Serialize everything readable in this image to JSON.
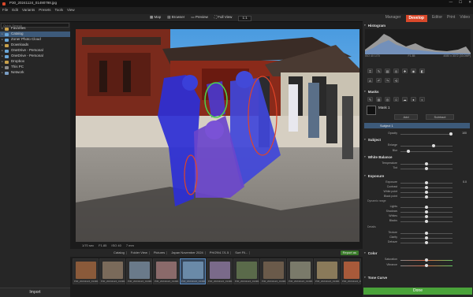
{
  "window": {
    "title": "P30_20241124_01490798.jpg"
  },
  "menu": [
    "File",
    "Edit",
    "Variants",
    "Presets",
    "Tools",
    "View"
  ],
  "toolbar": {
    "buttons": [
      "Map",
      "Browser",
      "Preview",
      "Full View"
    ],
    "user": "milesmoore@...",
    "zoom": "1:1"
  },
  "sidebar": {
    "search_placeholder": "Quick Search",
    "items": [
      {
        "label": "Favorites",
        "icon": "star-icon"
      },
      {
        "label": "Catalog",
        "icon": "catalog-icon"
      },
      {
        "label": "Zoner Photo Cloud",
        "icon": "cloud-icon"
      },
      {
        "label": "Downloads",
        "icon": "folder-icon"
      },
      {
        "label": "OneDrive - Personal",
        "icon": "cloud-icon"
      },
      {
        "label": "OneDrive - Personal",
        "icon": "cloud-icon"
      },
      {
        "label": "Dropbox",
        "icon": "folder-icon"
      },
      {
        "label": "This PC",
        "icon": "pc-icon"
      },
      {
        "label": "Network",
        "icon": "network-icon"
      }
    ],
    "import_label": "Import"
  },
  "modules": {
    "tabs": [
      "Manager",
      "Develop",
      "Editor",
      "Print",
      "Video"
    ],
    "active": "Develop"
  },
  "info_bar": {
    "items": [
      "1/70 sec",
      "F1.85",
      "ISO 40",
      "7 mm"
    ]
  },
  "breadcrumb": [
    "Catalog",
    "Folder View",
    "Pictures",
    "Japan November 2024",
    "PH/29/4.7/1.5",
    "Sort Fil..."
  ],
  "report_button": "Report as",
  "filmstrip": [
    {
      "label": "P30_20241124_01490..."
    },
    {
      "label": "P30_20241124_01490..."
    },
    {
      "label": "P30_20241124_01490..."
    },
    {
      "label": "P30_20241124_01490..."
    },
    {
      "label": "P30_20241124_01490..."
    },
    {
      "label": "P30_20241124_01490..."
    },
    {
      "label": "P30_20241124_01490..."
    },
    {
      "label": "P30_20241124_01490..."
    },
    {
      "label": "P30_20241124_01490..."
    },
    {
      "label": "P30_20241124_01490..."
    },
    {
      "label": "P30_20241124_01490..."
    }
  ],
  "histogram": {
    "title": "Histogram",
    "left_info": "ISO 40 1/70",
    "mid_info": "F1.85",
    "right_info": "4080 x 3072 (33.0MP)"
  },
  "masks": {
    "title": "Masks",
    "mask_name": "Mask 1",
    "add_label": "Add",
    "subtract_label": "Subtract",
    "subject_label": "Subject 1",
    "opacity_label": "Opacity",
    "opacity_value": "100"
  },
  "subject": {
    "title": "Subject",
    "enlarge": "Enlarge",
    "blur": "Blur"
  },
  "white_balance": {
    "title": "White Balance",
    "rows": [
      "Temperature",
      "Tint"
    ]
  },
  "exposure": {
    "title": "Exposure",
    "rows": [
      "Exposure",
      "Contrast",
      "White point",
      "Black point",
      "Dynamic range",
      "Lights",
      "Shadows",
      "Whites",
      "Blacks",
      "Details",
      "Texture",
      "Clarity",
      "Dehaze"
    ],
    "values": [
      "0.0",
      "",
      "",
      "",
      "",
      "",
      "",
      "",
      "",
      "",
      "",
      "",
      ""
    ]
  },
  "color": {
    "title": "Color",
    "rows": [
      "Saturation",
      "Vibrance"
    ]
  },
  "tone_curve": {
    "title": "Tone Curve"
  },
  "done_label": "Done"
}
